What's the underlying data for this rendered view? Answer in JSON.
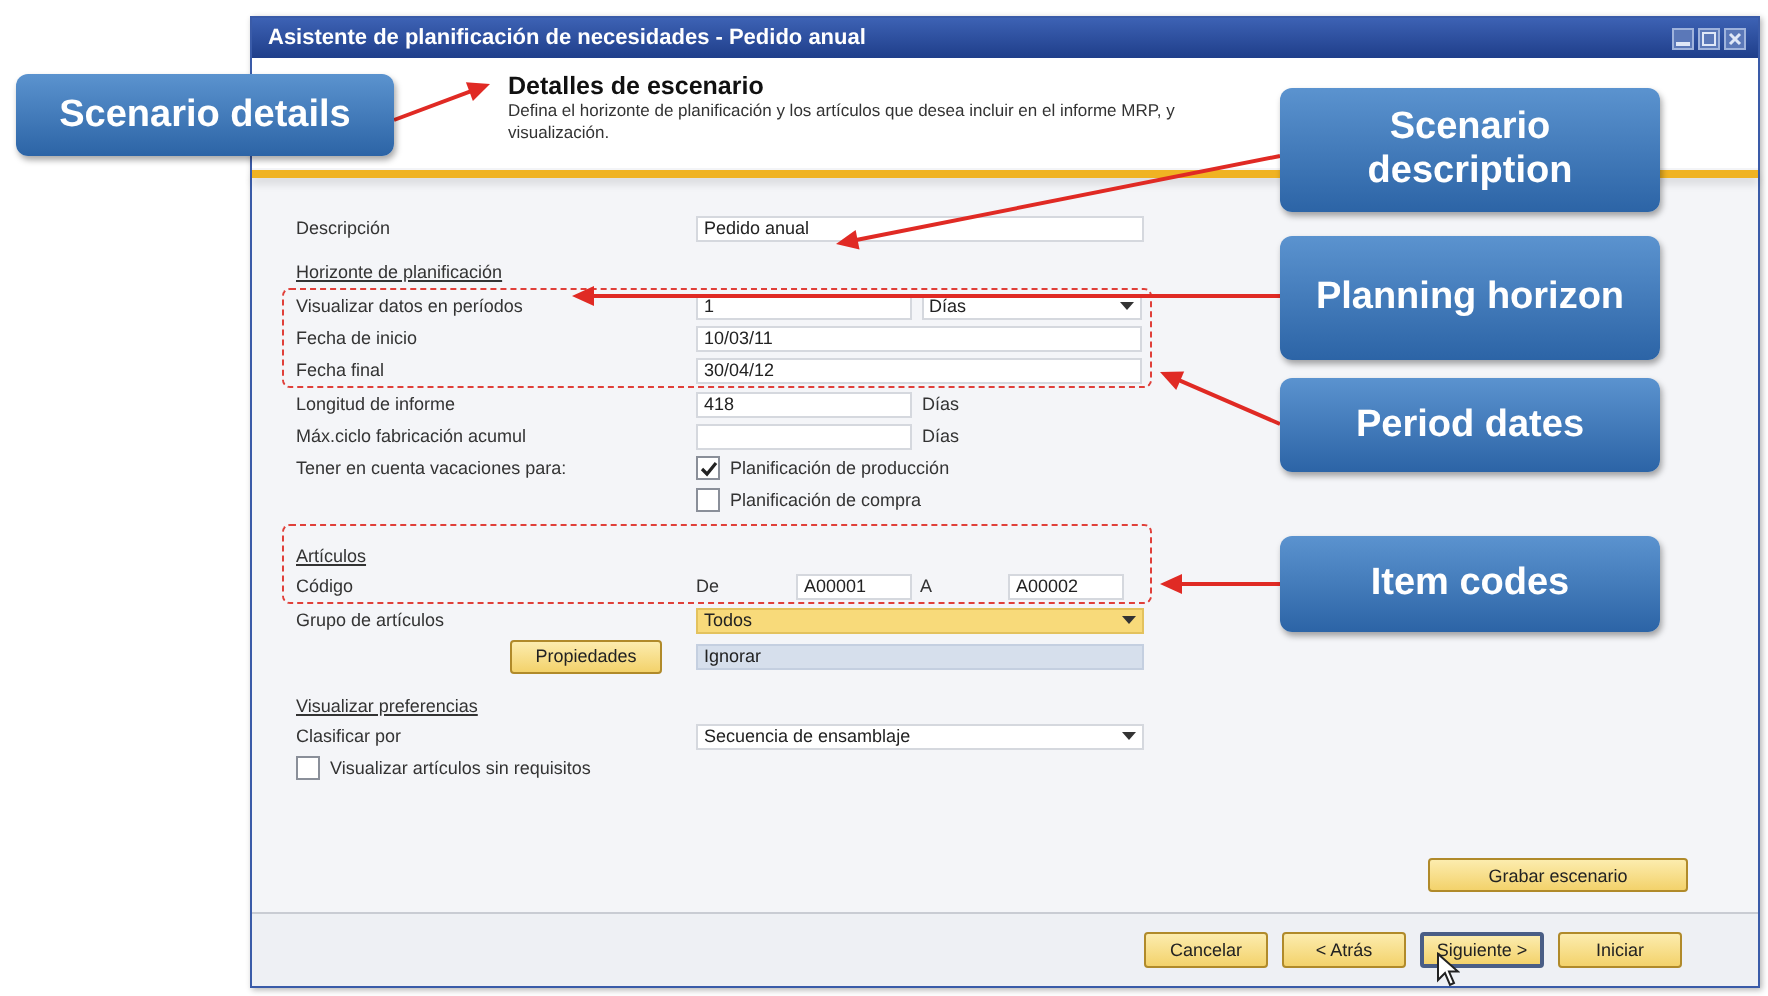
{
  "window": {
    "title": "Asistente de planificación de necesidades - Pedido anual"
  },
  "header": {
    "title": "Detalles de escenario",
    "description_lines": [
      "Defina el horizonte de planificación y los artículos que desea incluir en el informe MRP, y",
      "visualización."
    ]
  },
  "form": {
    "description": {
      "label": "Descripción",
      "value": "Pedido anual"
    },
    "planning_horizon": {
      "heading": "Horizonte de planificación",
      "periods": {
        "label": "Visualizar datos en períodos",
        "value": "1",
        "unit": "Días"
      },
      "start_date": {
        "label": "Fecha de inicio",
        "value": "10/03/11"
      },
      "end_date": {
        "label": "Fecha final",
        "value": "30/04/12"
      }
    },
    "report_length": {
      "label": "Longitud de informe",
      "value": "418",
      "unit": "Días"
    },
    "max_cycle": {
      "label": "Máx.ciclo fabricación acumul",
      "unit": "Días"
    },
    "holidays": {
      "label": "Tener en cuenta vacaciones para:",
      "options": [
        {
          "label": "Planificación de producción",
          "checked": true
        },
        {
          "label": "Planificación de compra",
          "checked": false
        }
      ]
    },
    "items": {
      "heading": "Artículos",
      "code_label": "Código",
      "from_label": "De",
      "from": "A00001",
      "to_label": "A",
      "to": "A00002"
    },
    "item_group": {
      "label": "Grupo de artículos",
      "value": "Todos"
    },
    "properties": {
      "button": "Propiedades",
      "value": "Ignorar"
    },
    "display": {
      "heading": "Visualizar preferencias",
      "sort_label": "Clasificar por",
      "sort_value": "Secuencia de ensamblaje",
      "without_requirements": {
        "label": "Visualizar artículos sin requisitos",
        "checked": false
      }
    }
  },
  "save_button": "Grabar escenario",
  "buttons": [
    {
      "label": "Cancelar",
      "focused": false
    },
    {
      "label": "< Atrás",
      "focused": false
    },
    {
      "label": "Siguiente >",
      "focused": true
    },
    {
      "label": "Iniciar",
      "focused": false
    }
  ],
  "callouts": [
    {
      "text": "Scenario details"
    },
    {
      "text": "Scenario description"
    },
    {
      "text": "Planning horizon"
    },
    {
      "text": "Period dates"
    },
    {
      "text": "Item codes"
    }
  ]
}
